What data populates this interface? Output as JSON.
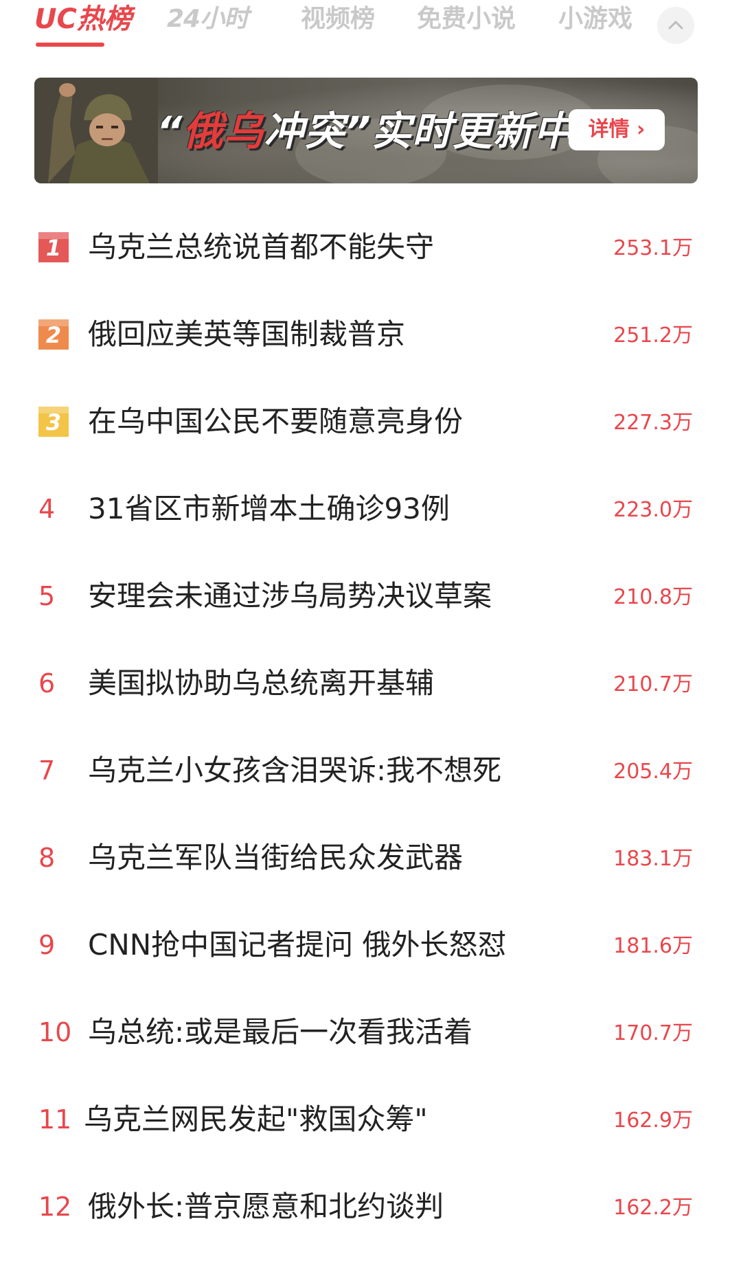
{
  "tabs": [
    {
      "label": "UC热榜",
      "active": true
    },
    {
      "label": "24小时",
      "active": false
    },
    {
      "label": "视频榜",
      "active": false
    },
    {
      "label": "免费小说",
      "active": false
    },
    {
      "label": "小游戏",
      "active": false
    }
  ],
  "collapse_icon": "chevron-up-icon",
  "banner": {
    "title_quote_open": "“",
    "title_highlight": "俄乌",
    "title_mid": "冲突",
    "title_quote_close": "”",
    "title_rest": "实时更新中",
    "button_label": "详情 ›"
  },
  "list": [
    {
      "rank": "1",
      "title": "乌克兰总统说首都不能失守",
      "heat": "253.1万"
    },
    {
      "rank": "2",
      "title": "俄回应美英等国制裁普京",
      "heat": "251.2万"
    },
    {
      "rank": "3",
      "title": "在乌中国公民不要随意亮身份",
      "heat": "227.3万"
    },
    {
      "rank": "4",
      "title": "31省区市新增本土确诊93例",
      "heat": "223.0万"
    },
    {
      "rank": "5",
      "title": "安理会未通过涉乌局势决议草案",
      "heat": "210.8万"
    },
    {
      "rank": "6",
      "title": "美国拟协助乌总统离开基辅",
      "heat": "210.7万"
    },
    {
      "rank": "7",
      "title": "乌克兰小女孩含泪哭诉:我不想死",
      "heat": "205.4万"
    },
    {
      "rank": "8",
      "title": "乌克兰军队当街给民众发武器",
      "heat": "183.1万"
    },
    {
      "rank": "9",
      "title": "CNN抢中国记者提问 俄外长怒怼",
      "heat": "181.6万"
    },
    {
      "rank": "10",
      "title": "乌总统:或是最后一次看我活着",
      "heat": "170.7万"
    },
    {
      "rank": "11",
      "title": "乌克兰网民发起\"救国众筹\"",
      "heat": "162.9万"
    },
    {
      "rank": "12",
      "title": "俄外长:普京愿意和北约谈判",
      "heat": "162.2万"
    }
  ],
  "colors": {
    "accent": "#e8474c",
    "rank1": "#e45858",
    "rank2": "#ee8a4c",
    "rank3": "#f2c448",
    "tab_inactive": "#c9c9c9"
  }
}
